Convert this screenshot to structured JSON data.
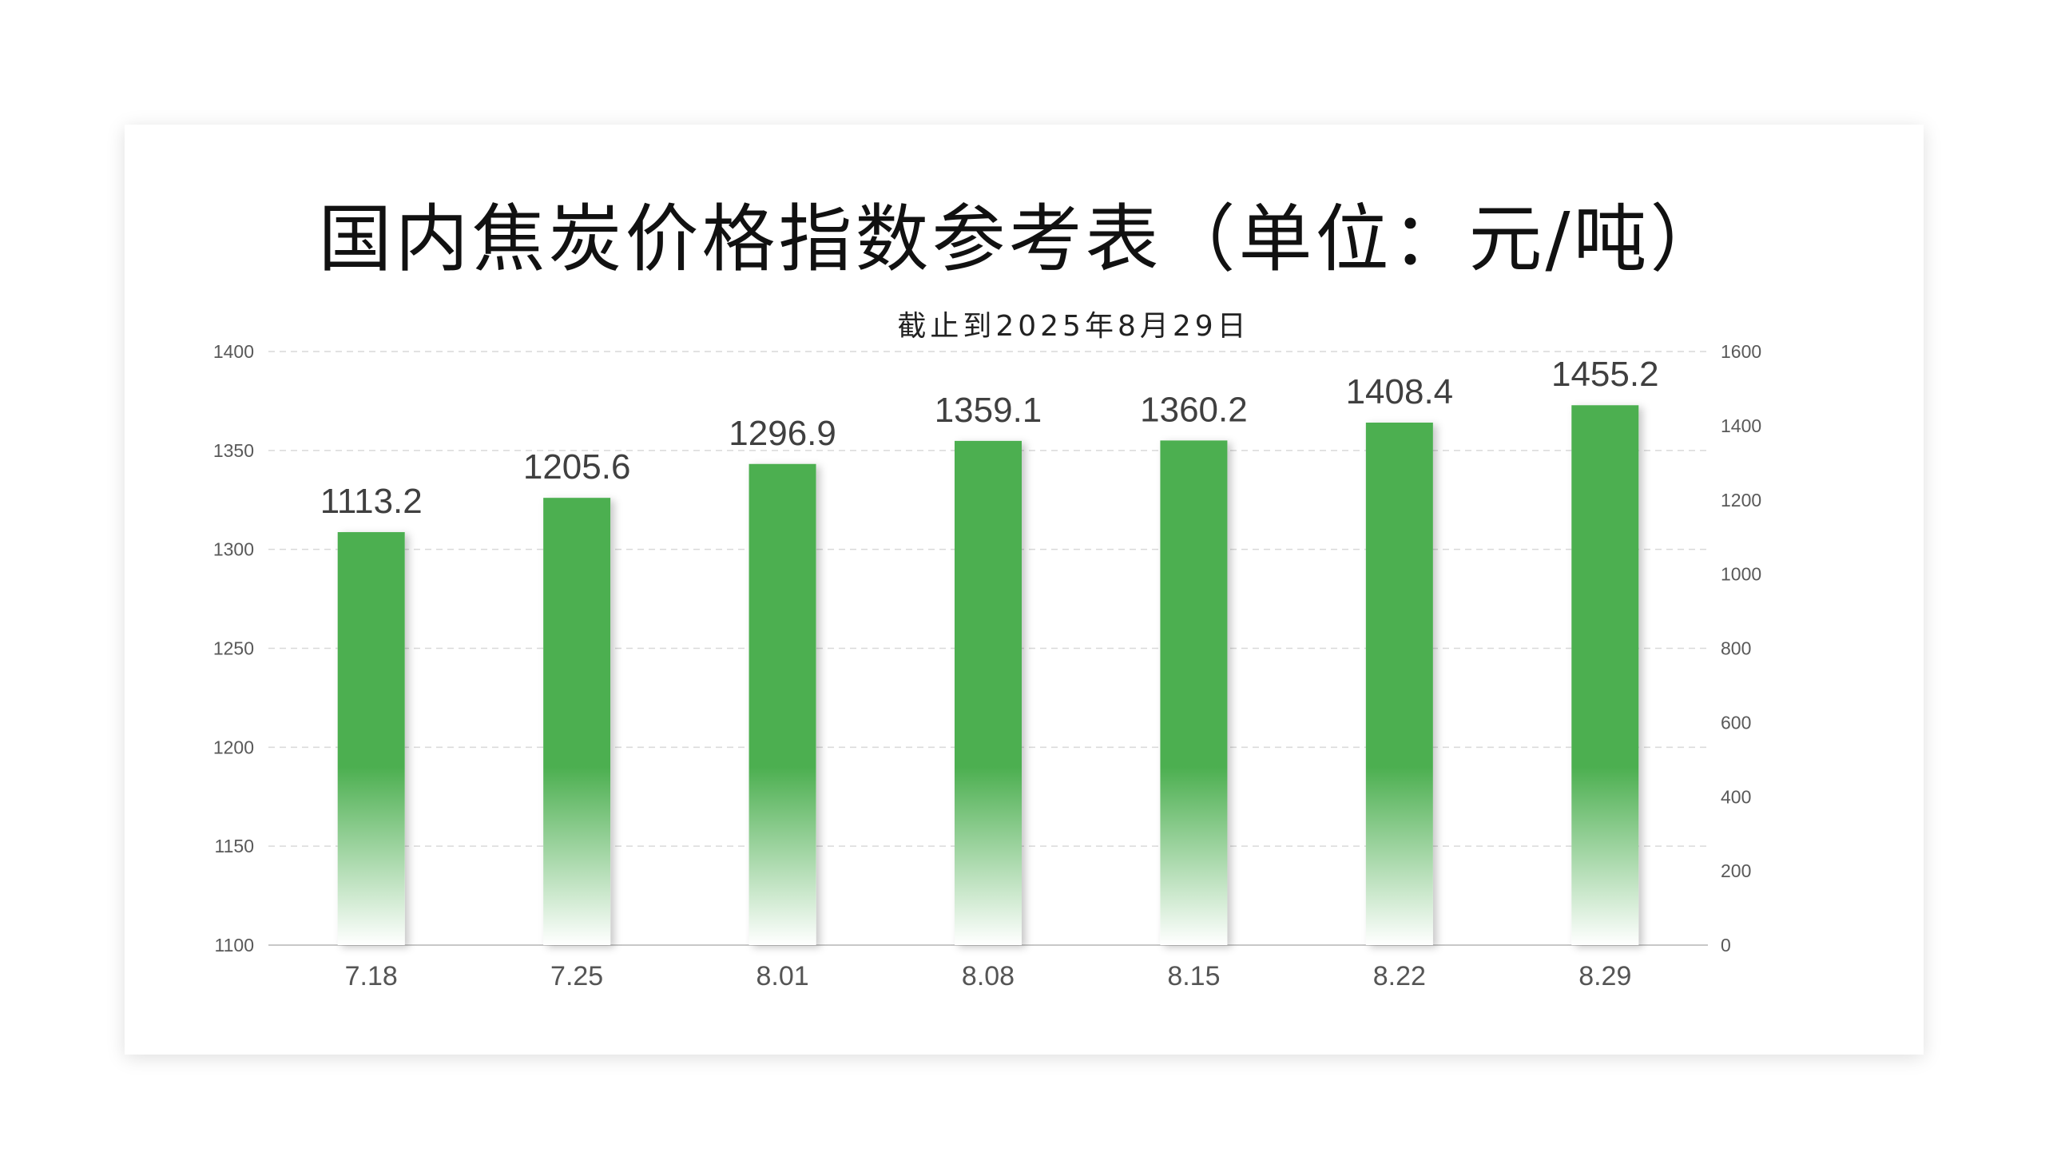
{
  "chart_data": {
    "type": "bar",
    "title": "国内焦炭价格指数参考表（单位：元/吨）",
    "subtitle": "截止到2025年8月29日",
    "categories": [
      "7.18",
      "7.25",
      "8.01",
      "8.08",
      "8.15",
      "8.22",
      "8.29"
    ],
    "values": [
      1113.2,
      1205.6,
      1296.9,
      1359.1,
      1360.2,
      1408.4,
      1455.2
    ],
    "data_labels": [
      "1113.2",
      "1205.6",
      "1296.9",
      "1359.1",
      "1360.2",
      "1408.4",
      "1455.2"
    ],
    "left_axis": {
      "min": 1100,
      "max": 1400,
      "ticks": [
        "1100",
        "1150",
        "1200",
        "1250",
        "1300",
        "1350",
        "1400"
      ]
    },
    "right_axis": {
      "min": 0,
      "max": 1600,
      "ticks": [
        "0",
        "200",
        "400",
        "600",
        "800",
        "1000",
        "1200",
        "1400",
        "1600"
      ]
    },
    "bar_color": "#4caf50",
    "grid": true,
    "grid_style": "dashed"
  }
}
